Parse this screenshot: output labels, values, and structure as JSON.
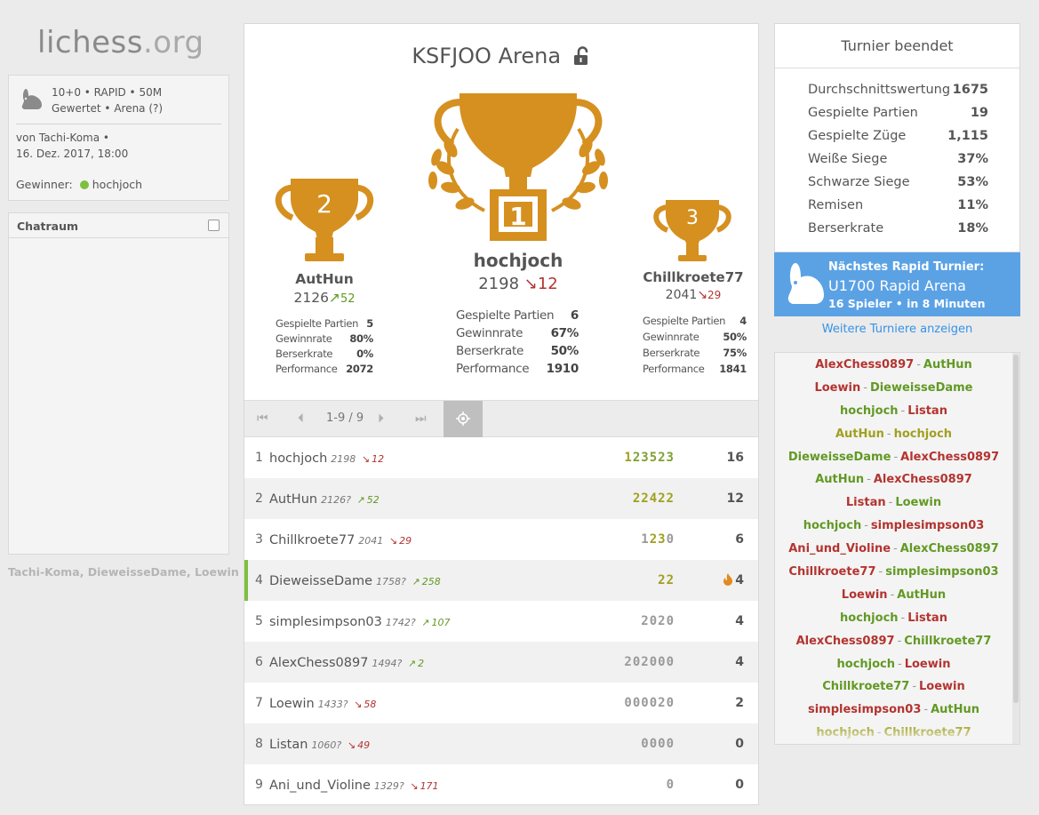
{
  "site": {
    "logo_main": "lichess",
    "logo_domain": ".org"
  },
  "info": {
    "setup_line1": "10+0 • RAPID • 50M",
    "setup_line2": "Gewertet • Arena (?)",
    "created_by": "von Tachi-Koma •",
    "date": "16. Dez. 2017, 18:00",
    "winner_label": "Gewinner:",
    "winner_name": "hochjoch"
  },
  "chat": {
    "title": "Chatraum"
  },
  "watchers": "Tachi-Koma, DieweisseDame, Loewin",
  "tournament": {
    "name": "KSFJOO Arena"
  },
  "podium": {
    "first": {
      "place": "1",
      "name": "hochjoch",
      "rating": "2198",
      "prog": "12",
      "prog_dir": "down",
      "stats": [
        {
          "label": "Gespielte Partien",
          "value": "6"
        },
        {
          "label": "Gewinnrate",
          "value": "67%"
        },
        {
          "label": "Berserkrate",
          "value": "50%"
        },
        {
          "label": "Performance",
          "value": "1910"
        }
      ]
    },
    "second": {
      "place": "2",
      "name": "AutHun",
      "rating": "2126",
      "prog": "52",
      "prog_dir": "up",
      "stats": [
        {
          "label": "Gespielte Partien",
          "value": "5"
        },
        {
          "label": "Gewinnrate",
          "value": "80%"
        },
        {
          "label": "Berserkrate",
          "value": "0%"
        },
        {
          "label": "Performance",
          "value": "2072"
        }
      ]
    },
    "third": {
      "place": "3",
      "name": "Chillkroete77",
      "rating": "2041",
      "prog": "29",
      "prog_dir": "down",
      "stats": [
        {
          "label": "Gespielte Partien",
          "value": "4"
        },
        {
          "label": "Gewinnrate",
          "value": "50%"
        },
        {
          "label": "Berserkrate",
          "value": "75%"
        },
        {
          "label": "Performance",
          "value": "1841"
        }
      ]
    }
  },
  "pager": {
    "pages": "1-9 / 9"
  },
  "standings": [
    {
      "rank": "1",
      "name": "hochjoch",
      "rating": "2198",
      "prog": "12",
      "dir": "down",
      "sheet": "123523",
      "total": "16"
    },
    {
      "rank": "2",
      "name": "AutHun",
      "rating": "2126?",
      "prog": "52",
      "dir": "up",
      "sheet": "22422",
      "total": "12"
    },
    {
      "rank": "3",
      "name": "Chillkroete77",
      "rating": "2041",
      "prog": "29",
      "dir": "down",
      "sheet": "1230",
      "total": "6"
    },
    {
      "rank": "4",
      "name": "DieweisseDame",
      "rating": "1758?",
      "prog": "258",
      "dir": "up",
      "sheet": "22",
      "total": "4"
    },
    {
      "rank": "5",
      "name": "simplesimpson03",
      "rating": "1742?",
      "prog": "107",
      "dir": "up",
      "sheet": "2020",
      "total": "4"
    },
    {
      "rank": "6",
      "name": "AlexChess0897",
      "rating": "1494?",
      "prog": "2",
      "dir": "up",
      "sheet": "202000",
      "total": "4"
    },
    {
      "rank": "7",
      "name": "Loewin",
      "rating": "1433?",
      "prog": "58",
      "dir": "down",
      "sheet": "000020",
      "total": "2"
    },
    {
      "rank": "8",
      "name": "Listan",
      "rating": "1060?",
      "prog": "49",
      "dir": "down",
      "sheet": "0000",
      "total": "0"
    },
    {
      "rank": "9",
      "name": "Ani_und_Violine",
      "rating": "1329?",
      "prog": "171",
      "dir": "down",
      "sheet": "0",
      "total": "0"
    }
  ],
  "stats": {
    "title": "Turnier beendet",
    "rows": [
      {
        "label": "Durchschnittswertung",
        "value": "1675"
      },
      {
        "label": "Gespielte Partien",
        "value": "19"
      },
      {
        "label": "Gespielte Züge",
        "value": "1,115"
      },
      {
        "label": "Weiße Siege",
        "value": "37%"
      },
      {
        "label": "Schwarze Siege",
        "value": "53%"
      },
      {
        "label": "Remisen",
        "value": "11%"
      },
      {
        "label": "Berserkrate",
        "value": "18%"
      }
    ]
  },
  "next": {
    "label": "Nächstes Rapid Turnier:",
    "name": "U1700 Rapid Arena",
    "meta": "16 Spieler • in 8 Minuten"
  },
  "more_link": "Weitere Turniere anzeigen",
  "colors": {
    "win": "#629924",
    "loss": "#b33430",
    "draw": "#a0a020",
    "accent": "#5ba2e5",
    "trophy": "#d59020"
  },
  "pairings": [
    {
      "white": "AlexChess0897",
      "black": "AutHun",
      "result": "black"
    },
    {
      "white": "Loewin",
      "black": "DieweisseDame",
      "result": "black"
    },
    {
      "white": "hochjoch",
      "black": "Listan",
      "result": "white"
    },
    {
      "white": "AutHun",
      "black": "hochjoch",
      "result": "draw"
    },
    {
      "white": "DieweisseDame",
      "black": "AlexChess0897",
      "result": "white"
    },
    {
      "white": "AutHun",
      "black": "AlexChess0897",
      "result": "white"
    },
    {
      "white": "Listan",
      "black": "Loewin",
      "result": "black"
    },
    {
      "white": "hochjoch",
      "black": "simplesimpson03",
      "result": "white"
    },
    {
      "white": "Ani_und_Violine",
      "black": "AlexChess0897",
      "result": "black"
    },
    {
      "white": "Chillkroete77",
      "black": "simplesimpson03",
      "result": "black"
    },
    {
      "white": "Loewin",
      "black": "AutHun",
      "result": "black"
    },
    {
      "white": "hochjoch",
      "black": "Listan",
      "result": "white"
    },
    {
      "white": "AlexChess0897",
      "black": "Chillkroete77",
      "result": "black"
    },
    {
      "white": "hochjoch",
      "black": "Loewin",
      "result": "white"
    },
    {
      "white": "Chillkroete77",
      "black": "Loewin",
      "result": "white"
    },
    {
      "white": "simplesimpson03",
      "black": "AutHun",
      "result": "black"
    },
    {
      "white": "hochjoch",
      "black": "Chillkroete77",
      "result": "draw"
    }
  ]
}
